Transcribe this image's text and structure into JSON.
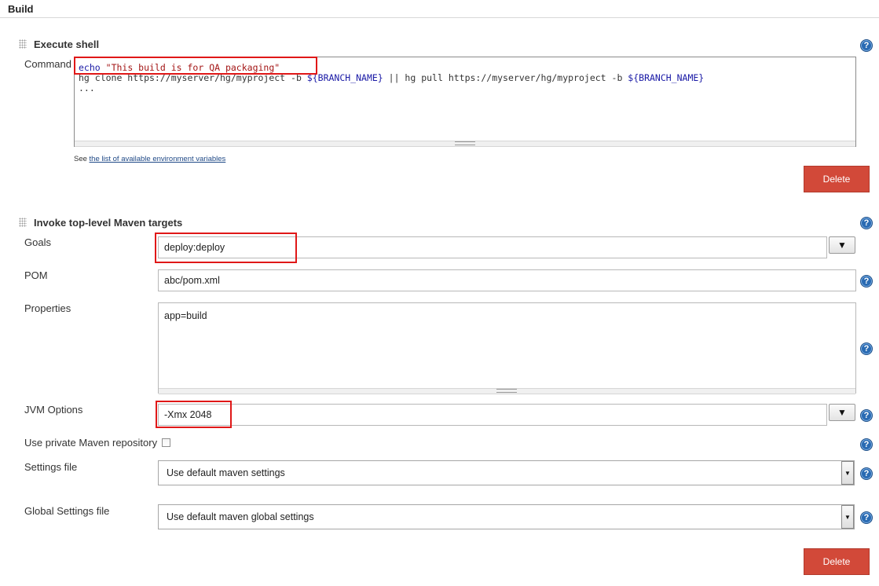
{
  "section": {
    "title": "Build"
  },
  "execute_shell": {
    "title": "Execute shell",
    "command_label": "Command",
    "command_line1_echo": "echo",
    "command_line1_string": "\"This build is for QA packaging\"",
    "command_line2_a": "hg clone https://myserver/hg/myproject -b ",
    "command_line2_var1": "${BRANCH_NAME}",
    "command_line2_b": " || hg pull https://myserver/hg/myproject -b ",
    "command_line2_var2": "${BRANCH_NAME}",
    "command_line3": "...",
    "see_prefix": "See ",
    "env_link": "the list of available environment variables",
    "delete_label": "Delete"
  },
  "maven": {
    "title": "Invoke top-level Maven targets",
    "goals_label": "Goals",
    "goals_value": "deploy:deploy",
    "pom_label": "POM",
    "pom_value": "abc/pom.xml",
    "properties_label": "Properties",
    "properties_value": "app=build",
    "jvm_label": "JVM Options",
    "jvm_value": "-Xmx 2048",
    "private_repo_label": "Use private Maven repository",
    "settings_label": "Settings file",
    "settings_value": "Use default maven settings",
    "global_settings_label": "Global Settings file",
    "global_settings_value": "Use default maven global settings",
    "delete_label": "Delete",
    "dropdown_glyph": "▼"
  },
  "help_glyph": "?",
  "colors": {
    "highlight": "#e01818",
    "delete": "#d24939",
    "help": "#2a6bb3",
    "shell_keyword": "#1a1aa6",
    "shell_string": "#a31515"
  }
}
